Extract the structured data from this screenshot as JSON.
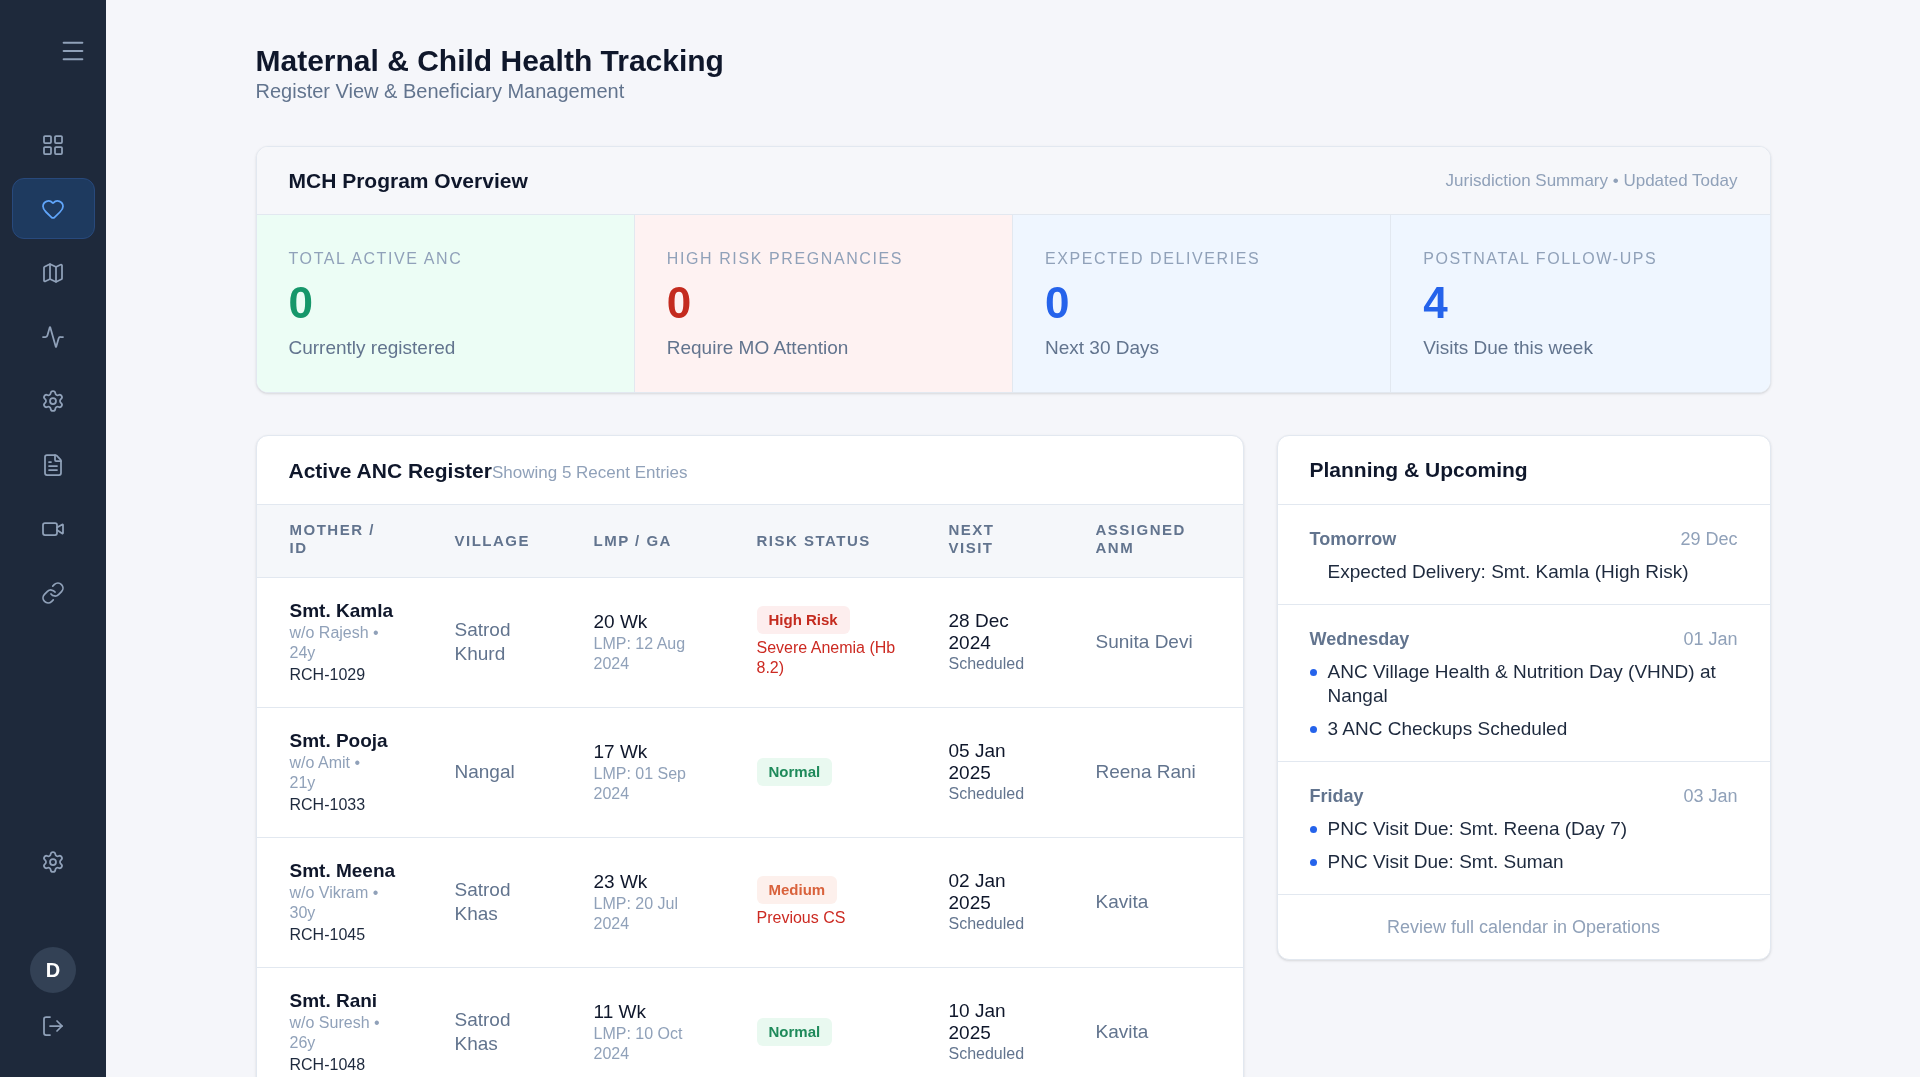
{
  "sidebar": {
    "nav": [
      {
        "selected": false
      },
      {
        "selected": true
      },
      {
        "selected": false
      },
      {
        "selected": false
      },
      {
        "selected": false
      },
      {
        "selected": false
      },
      {
        "selected": false
      },
      {
        "selected": false
      }
    ],
    "bottom": [
      {
        "selected": false
      }
    ],
    "user": {
      "initial": "D"
    }
  },
  "header": {
    "title": "Maternal & Child Health Tracking",
    "subtitle": "Register View & Beneficiary Management"
  },
  "overview": {
    "title": "MCH Program Overview",
    "meta": "Jurisdiction Summary • Updated Today",
    "stats": [
      {
        "kind": "positive",
        "label": "TOTAL ACTIVE ANC",
        "value": "0",
        "caption": "Currently registered"
      },
      {
        "kind": "alert",
        "label": "HIGH RISK PREGNANCIES",
        "value": "0",
        "caption": "Require MO Attention"
      },
      {
        "kind": "info",
        "label": "EXPECTED DELIVERIES",
        "value": "0",
        "caption": "Next 30 Days"
      },
      {
        "kind": "info",
        "label": "POSTNATAL FOLLOW-UPS",
        "value": "4",
        "caption": "Visits Due this week"
      }
    ]
  },
  "register": {
    "title": "Active ANC Register",
    "subtitle": "Showing 5 Recent Entries",
    "columns": [
      "MOTHER / ID",
      "VILLAGE",
      "LMP / GA",
      "RISK STATUS",
      "NEXT VISIT",
      "ASSIGNED ANM"
    ],
    "rows": [
      {
        "name": "Smt. Kamla",
        "details": "w/o Rajesh • 24y",
        "id": "RCH-1029",
        "village": "Satrod Khurd",
        "ga": "20 Wk",
        "lmp": "LMP: 12 Aug 2024",
        "risk": {
          "kind": "high",
          "label": "High Risk"
        },
        "risk_note": "Severe Anemia (Hb 8.2)",
        "next_visit": "28 Dec 2024",
        "visit_status": "Scheduled",
        "anm": "Sunita Devi"
      },
      {
        "name": "Smt. Pooja",
        "details": "w/o Amit • 21y",
        "id": "RCH-1033",
        "village": "Nangal",
        "ga": "17 Wk",
        "lmp": "LMP: 01 Sep 2024",
        "risk": {
          "kind": "normal",
          "label": "Normal"
        },
        "next_visit": "05 Jan 2025",
        "visit_status": "Scheduled",
        "anm": "Reena Rani"
      },
      {
        "name": "Smt. Meena",
        "details": "w/o Vikram • 30y",
        "id": "RCH-1045",
        "village": "Satrod Khas",
        "ga": "23 Wk",
        "lmp": "LMP: 20 Jul 2024",
        "risk": {
          "kind": "medium",
          "label": "Medium"
        },
        "risk_note": "Previous CS",
        "next_visit": "02 Jan 2025",
        "visit_status": "Scheduled",
        "anm": "Kavita"
      },
      {
        "name": "Smt. Rani",
        "details": "w/o Suresh • 26y",
        "id": "RCH-1048",
        "village": "Satrod Khas",
        "ga": "11 Wk",
        "lmp": "LMP: 10 Oct 2024",
        "risk": {
          "kind": "normal",
          "label": "Normal"
        },
        "next_visit": "10 Jan 2025",
        "visit_status": "Scheduled",
        "anm": "Kavita"
      }
    ]
  },
  "planning": {
    "title": "Planning & Upcoming",
    "days": [
      {
        "day": "Tomorrow",
        "date": "29 Dec",
        "items": [
          {
            "kind": "plain",
            "text": "Expected Delivery: Smt. Kamla (High Risk)"
          }
        ]
      },
      {
        "day": "Wednesday",
        "date": "01 Jan",
        "items": [
          {
            "kind": "bullet",
            "text": "ANC Village Health & Nutrition Day (VHND) at Nangal"
          },
          {
            "kind": "bullet",
            "text": "3 ANC Checkups Scheduled"
          }
        ]
      },
      {
        "day": "Friday",
        "date": "03 Jan",
        "items": [
          {
            "kind": "bullet",
            "text": "PNC Visit Due: Smt. Reena (Day 7)"
          },
          {
            "kind": "bullet",
            "text": "PNC Visit Due: Smt. Suman"
          }
        ]
      }
    ],
    "footer_link": "Review full calendar in Operations"
  }
}
